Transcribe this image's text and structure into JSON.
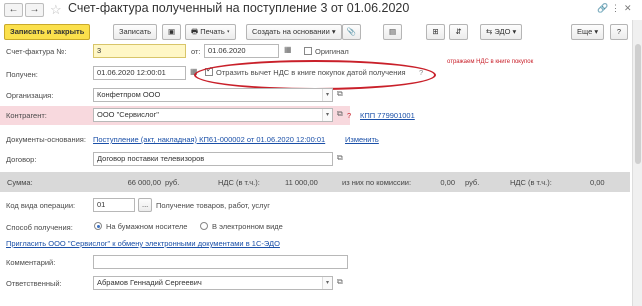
{
  "window": {
    "title": "Счет-фактура полученный на поступление 3 от 01.06.2020",
    "nav_back_icon": "arrow-left-icon",
    "nav_forward_icon": "arrow-right-icon",
    "favorite_icon": "star-icon",
    "controls": [
      "link-icon",
      "more-icon",
      "close-icon"
    ]
  },
  "toolbar": {
    "save_close_label": "Записать и закрыть",
    "save_label": "Записать",
    "print_label": "Печать",
    "create_based_label": "Создать на основании",
    "edo_label": "ЭДО",
    "more_label": "Еще",
    "help_label": "?"
  },
  "form": {
    "invoice_number_label": "Счет-фактура №:",
    "invoice_number_value": "3",
    "date_from_label": "от:",
    "date_value": "01.06.2020",
    "original_label": "Оригинал",
    "received_label": "Получен:",
    "received_value": "01.06.2020 12:00:01",
    "vat_checkbox_label": "Отразить вычет НДС в книге покупок датой получения",
    "vat_help": "?",
    "organization_label": "Организация:",
    "organization_value": "Конфетпром ООО",
    "counterparty_label": "Контрагент:",
    "counterparty_value": "ООО \"Сервислог\"",
    "kpp_link": "КПП 779901001",
    "documents_label": "Документы-основания:",
    "documents_link": "Поступление (акт, накладная) КП61-000002 от 01.06.2020 12:00:01",
    "documents_edit": "Изменить",
    "contract_label": "Договор:",
    "contract_value": "Договор поставки телевизоров",
    "op_code_label": "Код вида операции:",
    "op_code_value": "01",
    "op_code_desc": "Получение товаров, работ, услуг",
    "method_label": "Способ получения:",
    "method_paper": "На бумажном носителе",
    "method_electronic": "В электронном виде",
    "invite_link": "Пригласить ООО \"Сервислог\" к обмену электронными документами в 1С-ЭДО",
    "comment_label": "Комментарий:",
    "comment_value": "",
    "responsible_label": "Ответственный:",
    "responsible_value": "Абрамов Геннадий Сергеевич"
  },
  "sums": {
    "sum_label": "Сумма:",
    "sum_value": "66 000,00",
    "currency": "руб.",
    "vat_label": "НДС (в т.ч.):",
    "vat_value": "11 000,00",
    "commission_label": "из них по комиссии:",
    "commission_value": "0,00",
    "currency2": "руб.",
    "vat2_label": "НДС (в т.ч.):",
    "vat2_value": "0,00"
  },
  "annotation": {
    "text": "отражаем НДС в книге покупок"
  },
  "colors": {
    "primary_button": "#fbe04c",
    "highlight_row": "#f8d9de",
    "annotation": "#c9202a",
    "link": "#1b50a8"
  }
}
